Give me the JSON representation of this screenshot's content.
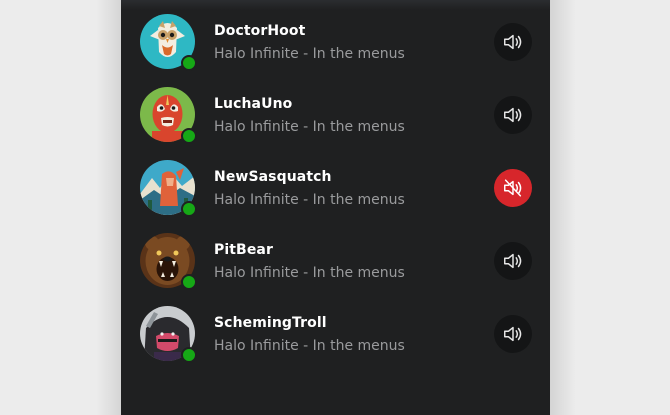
{
  "players": [
    {
      "gamertag": "DoctorHoot",
      "activity": "Halo Infinite - In the menus",
      "muted": false,
      "avatar_icon": "owl-avatar-icon",
      "online": true
    },
    {
      "gamertag": "LuchaUno",
      "activity": "Halo Infinite - In the menus",
      "muted": false,
      "avatar_icon": "luchador-avatar-icon",
      "online": true
    },
    {
      "gamertag": "NewSasquatch",
      "activity": "Halo Infinite - In the menus",
      "muted": true,
      "avatar_icon": "sasquatch-avatar-icon",
      "online": true
    },
    {
      "gamertag": "PitBear",
      "activity": "Halo Infinite - In the menus",
      "muted": false,
      "avatar_icon": "bear-avatar-icon",
      "online": true
    },
    {
      "gamertag": "SchemingTroll",
      "activity": "Halo Infinite - In the menus",
      "muted": false,
      "avatar_icon": "troll-avatar-icon",
      "online": true
    }
  ],
  "colors": {
    "panel_bg": "#1f2021",
    "presence_online": "#16a816",
    "muted_button": "#d7262b",
    "unmuted_button": "#141516"
  }
}
